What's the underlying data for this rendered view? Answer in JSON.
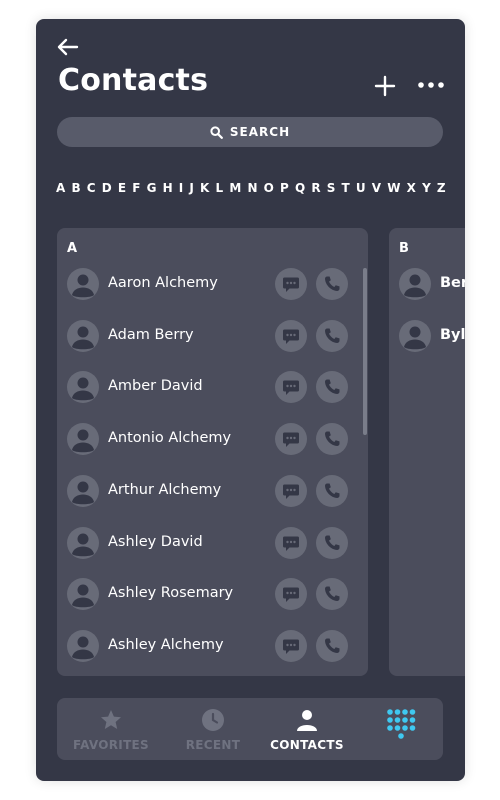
{
  "header": {
    "title": "Contacts"
  },
  "search": {
    "label": "SEARCH"
  },
  "alphabet": [
    "A",
    "B",
    "C",
    "D",
    "E",
    "F",
    "G",
    "H",
    "I",
    "J",
    "K",
    "L",
    "M",
    "N",
    "O",
    "P",
    "Q",
    "R",
    "S",
    "T",
    "U",
    "V",
    "W",
    "X",
    "Y",
    "Z"
  ],
  "sections": [
    {
      "letter": "A",
      "contacts": [
        {
          "name": "Aaron Alchemy"
        },
        {
          "name": "Adam Berry"
        },
        {
          "name": "Amber David"
        },
        {
          "name": "Antonio Alchemy"
        },
        {
          "name": "Arthur Alchemy"
        },
        {
          "name": "Ashley David"
        },
        {
          "name": "Ashley Rosemary"
        },
        {
          "name": "Ashley Alchemy"
        }
      ]
    },
    {
      "letter": "B",
      "contacts": [
        {
          "name": "Ber"
        },
        {
          "name": "Byli"
        }
      ]
    }
  ],
  "tabs": [
    {
      "label": "FAVORITES",
      "icon": "star-icon",
      "active": false
    },
    {
      "label": "RECENT",
      "icon": "clock-icon",
      "active": false
    },
    {
      "label": "CONTACTS",
      "icon": "person-icon",
      "active": true
    },
    {
      "label": "",
      "icon": "dialpad-icon",
      "active": false
    }
  ],
  "colors": {
    "background": "#343746",
    "panel": "#4b4d5c",
    "search": "#585b6a",
    "icon_circle": "#686b78",
    "accent": "#3fc8f0",
    "inactive_tab": "#6f7280"
  }
}
